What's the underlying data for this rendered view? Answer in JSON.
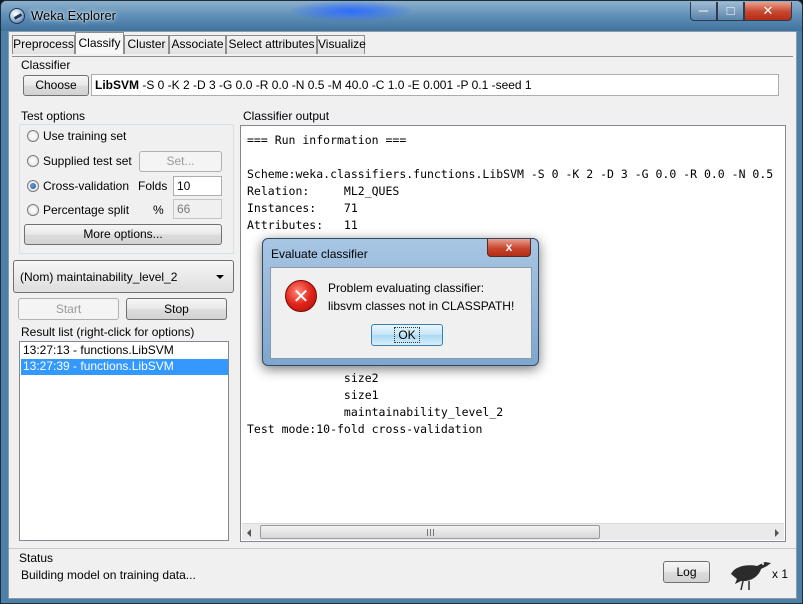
{
  "window": {
    "title": "Weka Explorer",
    "min": "─",
    "max": "□",
    "close": "✕"
  },
  "tabs": [
    "Preprocess",
    "Classify",
    "Cluster",
    "Associate",
    "Select attributes",
    "Visualize"
  ],
  "classifier": {
    "section": "Classifier",
    "choose": "Choose",
    "name": "LibSVM",
    "options": " -S 0 -K 2 -D 3 -G 0.0 -R 0.0 -N 0.5 -M 40.0 -C 1.0 -E 0.001 -P 0.1 -seed 1"
  },
  "test_options": {
    "section": "Test options",
    "use_training": "Use training set",
    "supplied": "Supplied test set",
    "set_button": "Set...",
    "cross_validation": "Cross-validation",
    "folds_label": "Folds",
    "folds_value": "10",
    "percentage_split": "Percentage split",
    "percent_sign": "%",
    "percent_value": "66",
    "more_options": "More options...",
    "selected": "cross_validation"
  },
  "class_attribute": "(Nom) maintainability_level_2",
  "start": "Start",
  "stop": "Stop",
  "result_list": {
    "label": "Result list (right-click for options)",
    "items": [
      "13:27:13 - functions.LibSVM",
      "13:27:39 - functions.LibSVM"
    ],
    "selected_index": 1
  },
  "output": {
    "label": "Classifier output",
    "lines": [
      "=== Run information ===",
      "",
      "Scheme:weka.classifiers.functions.LibSVM -S 0 -K 2 -D 3 -G 0.0 -R 0.0 -N 0.5",
      "Relation:     ML2_QUES",
      "Instances:    71",
      "Attributes:   11",
      "",
      "",
      "",
      "",
      "",
      "",
      "",
      "              size2",
      "              size1",
      "              maintainability_level_2",
      "Test mode:10-fold cross-validation"
    ]
  },
  "dialog": {
    "title": "Evaluate classifier",
    "close": "x",
    "message_1": "Problem evaluating classifier:",
    "message_2": "libsvm classes not in CLASSPATH!",
    "ok": "OK",
    "icon": "error-x-icon",
    "icon_glyph": "✕"
  },
  "status": {
    "label": "Status",
    "text": "Building model on training data...",
    "log": "Log",
    "threads": "x 1"
  },
  "colors": {
    "titlebar": "#5d8fb8",
    "selection": "#3399ff",
    "error": "#e2241a"
  }
}
